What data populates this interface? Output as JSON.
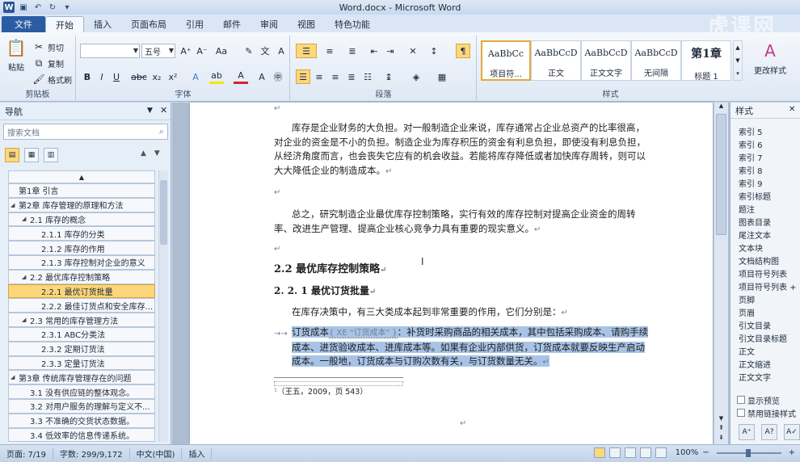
{
  "window": {
    "title": "Word.docx - Microsoft Word",
    "app_badge": "W",
    "watermark": "虎课网"
  },
  "tabs": [
    "文件",
    "开始",
    "插入",
    "页面布局",
    "引用",
    "邮件",
    "审阅",
    "视图",
    "特色功能"
  ],
  "ribbon": {
    "clipboard": {
      "paste": "粘贴",
      "cut": "剪切",
      "copy": "复制",
      "format_painter": "格式刷",
      "label": "剪贴板"
    },
    "font": {
      "font_size": "五号",
      "label": "字体"
    },
    "paragraph": {
      "label": "段落"
    },
    "styles": {
      "items": [
        {
          "preview": "AaBbCc",
          "name": "项目符..."
        },
        {
          "preview": "AaBbCcD",
          "name": "正文"
        },
        {
          "preview": "AaBbCcD",
          "name": "正文文字"
        },
        {
          "preview": "AaBbCcD",
          "name": "无间隔"
        },
        {
          "preview": "第1章",
          "name": "标题 1"
        }
      ],
      "change_styles": "更改样式",
      "label": "样式"
    }
  },
  "nav": {
    "title": "导航",
    "search_placeholder": "搜索文档",
    "items": [
      {
        "text": "第1章 引言",
        "level": 0,
        "expand": ""
      },
      {
        "text": "第2章 库存管理的原理和方法",
        "level": 0,
        "expand": "▲"
      },
      {
        "text": "2.1 库存的概念",
        "level": 1,
        "expand": "▲"
      },
      {
        "text": "2.1.1 库存的分类",
        "level": 2,
        "expand": ""
      },
      {
        "text": "2.1.2 库存的作用",
        "level": 2,
        "expand": ""
      },
      {
        "text": "2.1.3 库存控制对企业的意义",
        "level": 2,
        "expand": ""
      },
      {
        "text": "2.2 最优库存控制策略",
        "level": 1,
        "expand": "▲"
      },
      {
        "text": "2.2.1 最优订货批量",
        "level": 2,
        "expand": "",
        "selected": true
      },
      {
        "text": "2.2.2 最佳订货点和安全库存...",
        "level": 2,
        "expand": ""
      },
      {
        "text": "2.3 常用的库存管理方法",
        "level": 1,
        "expand": "▲"
      },
      {
        "text": "2.3.1 ABC分类法",
        "level": 2,
        "expand": ""
      },
      {
        "text": "2.3.2 定期订货法",
        "level": 2,
        "expand": ""
      },
      {
        "text": "2.3.3 定量订货法",
        "level": 2,
        "expand": ""
      },
      {
        "text": "第3章 传统库存管理存在的问题",
        "level": 0,
        "expand": "▲"
      },
      {
        "text": "3.1 没有供应链的整体观念。",
        "level": 1,
        "expand": ""
      },
      {
        "text": "3.2 对用户服务的理解与定义不...",
        "level": 1,
        "expand": ""
      },
      {
        "text": "3.3 不准确的交货状态数据。",
        "level": 1,
        "expand": ""
      },
      {
        "text": "3.4 低效率的信息传递系统。",
        "level": 1,
        "expand": ""
      }
    ]
  },
  "document": {
    "p1": "库存是企业财务的大负担。对一般制造企业来说，库存通常占企业总资产的比率很高，对企业的资金是不小的负担。制造企业为库存积压的资金有利息负担，即使没有利息负担，从经济角度而言，也会丧失它应有的机会收益。若能将库存降低或者加快库存周转，则可以大大降低企业的制造成本。",
    "p2": "总之，研究制造企业最优库存控制策略，实行有效的库存控制对提高企业资金的周转率、改进生产管理、提高企业核心竞争力具有重要的现实意义。",
    "h2": "2.2 最优库存控制策略",
    "h3": "2. 2. 1 最优订货批量",
    "p3": "在库存决策中，有三大类成本起到非常重要的作用，它们分别是：",
    "p4a": "订货成本",
    "field_code": "{ XE \"订货成本\" }",
    "p4b": "：补货时采购商品的相关成本，其中包括采购成本、请购手续成本、进货验收成本、进库成本等。如果有企业内部供货，订货成本就要反映生产启动成本。一般地，订货成本与订购次数有关，与订货数量无关。",
    "footnote": "（王五，2009，页 543）"
  },
  "styles_pane": {
    "title": "样式",
    "items": [
      "索引 5",
      "索引 6",
      "索引 7",
      "索引 8",
      "索引 9",
      "索引标题",
      "题注",
      "图表目录",
      "尾注文本",
      "文本块",
      "文档结构图",
      "项目符号列表",
      "项目符号列表 +",
      "页脚",
      "页眉",
      "引文目录",
      "引文目录标题",
      "正文",
      "正文缩进",
      "正文文字"
    ],
    "show_preview": "显示预览",
    "disable_linked": "禁用链接样式"
  },
  "status": {
    "page": "页面: 7/19",
    "words": "字数: 299/9,172",
    "language": "中文(中国)",
    "mode": "插入",
    "zoom": "100%"
  }
}
